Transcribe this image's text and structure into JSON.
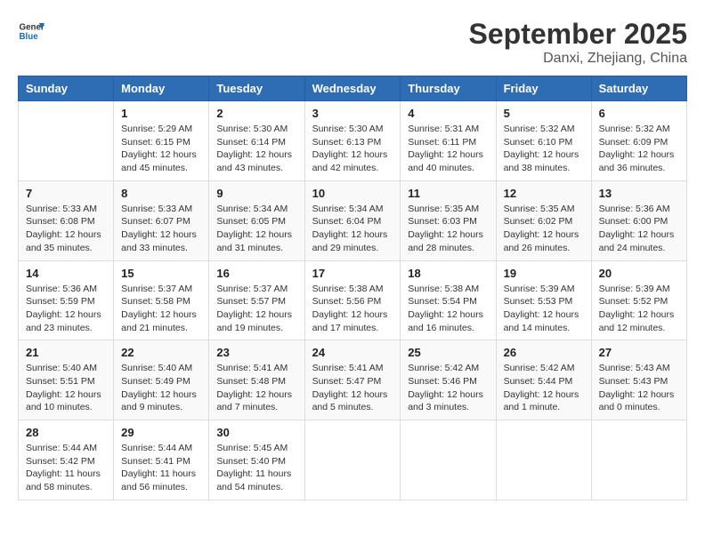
{
  "logo": {
    "text_general": "General",
    "text_blue": "Blue"
  },
  "header": {
    "title": "September 2025",
    "subtitle": "Danxi, Zhejiang, China"
  },
  "weekdays": [
    "Sunday",
    "Monday",
    "Tuesday",
    "Wednesday",
    "Thursday",
    "Friday",
    "Saturday"
  ],
  "weeks": [
    [
      {
        "day": "",
        "info": ""
      },
      {
        "day": "1",
        "info": "Sunrise: 5:29 AM\nSunset: 6:15 PM\nDaylight: 12 hours\nand 45 minutes."
      },
      {
        "day": "2",
        "info": "Sunrise: 5:30 AM\nSunset: 6:14 PM\nDaylight: 12 hours\nand 43 minutes."
      },
      {
        "day": "3",
        "info": "Sunrise: 5:30 AM\nSunset: 6:13 PM\nDaylight: 12 hours\nand 42 minutes."
      },
      {
        "day": "4",
        "info": "Sunrise: 5:31 AM\nSunset: 6:11 PM\nDaylight: 12 hours\nand 40 minutes."
      },
      {
        "day": "5",
        "info": "Sunrise: 5:32 AM\nSunset: 6:10 PM\nDaylight: 12 hours\nand 38 minutes."
      },
      {
        "day": "6",
        "info": "Sunrise: 5:32 AM\nSunset: 6:09 PM\nDaylight: 12 hours\nand 36 minutes."
      }
    ],
    [
      {
        "day": "7",
        "info": "Sunrise: 5:33 AM\nSunset: 6:08 PM\nDaylight: 12 hours\nand 35 minutes."
      },
      {
        "day": "8",
        "info": "Sunrise: 5:33 AM\nSunset: 6:07 PM\nDaylight: 12 hours\nand 33 minutes."
      },
      {
        "day": "9",
        "info": "Sunrise: 5:34 AM\nSunset: 6:05 PM\nDaylight: 12 hours\nand 31 minutes."
      },
      {
        "day": "10",
        "info": "Sunrise: 5:34 AM\nSunset: 6:04 PM\nDaylight: 12 hours\nand 29 minutes."
      },
      {
        "day": "11",
        "info": "Sunrise: 5:35 AM\nSunset: 6:03 PM\nDaylight: 12 hours\nand 28 minutes."
      },
      {
        "day": "12",
        "info": "Sunrise: 5:35 AM\nSunset: 6:02 PM\nDaylight: 12 hours\nand 26 minutes."
      },
      {
        "day": "13",
        "info": "Sunrise: 5:36 AM\nSunset: 6:00 PM\nDaylight: 12 hours\nand 24 minutes."
      }
    ],
    [
      {
        "day": "14",
        "info": "Sunrise: 5:36 AM\nSunset: 5:59 PM\nDaylight: 12 hours\nand 23 minutes."
      },
      {
        "day": "15",
        "info": "Sunrise: 5:37 AM\nSunset: 5:58 PM\nDaylight: 12 hours\nand 21 minutes."
      },
      {
        "day": "16",
        "info": "Sunrise: 5:37 AM\nSunset: 5:57 PM\nDaylight: 12 hours\nand 19 minutes."
      },
      {
        "day": "17",
        "info": "Sunrise: 5:38 AM\nSunset: 5:56 PM\nDaylight: 12 hours\nand 17 minutes."
      },
      {
        "day": "18",
        "info": "Sunrise: 5:38 AM\nSunset: 5:54 PM\nDaylight: 12 hours\nand 16 minutes."
      },
      {
        "day": "19",
        "info": "Sunrise: 5:39 AM\nSunset: 5:53 PM\nDaylight: 12 hours\nand 14 minutes."
      },
      {
        "day": "20",
        "info": "Sunrise: 5:39 AM\nSunset: 5:52 PM\nDaylight: 12 hours\nand 12 minutes."
      }
    ],
    [
      {
        "day": "21",
        "info": "Sunrise: 5:40 AM\nSunset: 5:51 PM\nDaylight: 12 hours\nand 10 minutes."
      },
      {
        "day": "22",
        "info": "Sunrise: 5:40 AM\nSunset: 5:49 PM\nDaylight: 12 hours\nand 9 minutes."
      },
      {
        "day": "23",
        "info": "Sunrise: 5:41 AM\nSunset: 5:48 PM\nDaylight: 12 hours\nand 7 minutes."
      },
      {
        "day": "24",
        "info": "Sunrise: 5:41 AM\nSunset: 5:47 PM\nDaylight: 12 hours\nand 5 minutes."
      },
      {
        "day": "25",
        "info": "Sunrise: 5:42 AM\nSunset: 5:46 PM\nDaylight: 12 hours\nand 3 minutes."
      },
      {
        "day": "26",
        "info": "Sunrise: 5:42 AM\nSunset: 5:44 PM\nDaylight: 12 hours\nand 1 minute."
      },
      {
        "day": "27",
        "info": "Sunrise: 5:43 AM\nSunset: 5:43 PM\nDaylight: 12 hours\nand 0 minutes."
      }
    ],
    [
      {
        "day": "28",
        "info": "Sunrise: 5:44 AM\nSunset: 5:42 PM\nDaylight: 11 hours\nand 58 minutes."
      },
      {
        "day": "29",
        "info": "Sunrise: 5:44 AM\nSunset: 5:41 PM\nDaylight: 11 hours\nand 56 minutes."
      },
      {
        "day": "30",
        "info": "Sunrise: 5:45 AM\nSunset: 5:40 PM\nDaylight: 11 hours\nand 54 minutes."
      },
      {
        "day": "",
        "info": ""
      },
      {
        "day": "",
        "info": ""
      },
      {
        "day": "",
        "info": ""
      },
      {
        "day": "",
        "info": ""
      }
    ]
  ]
}
